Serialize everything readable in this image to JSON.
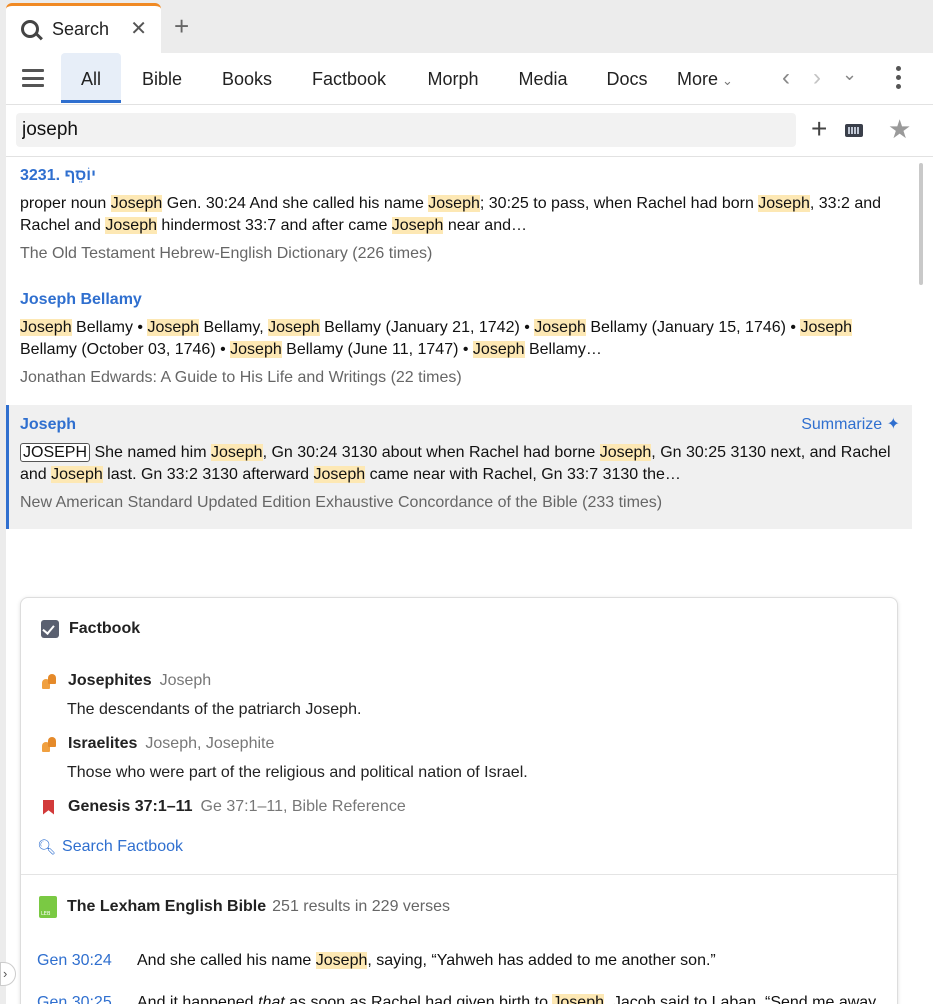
{
  "tab": {
    "label": "Search",
    "close": "✕",
    "new_tab": "+"
  },
  "nav": {
    "tabs": [
      "All",
      "Bible",
      "Books",
      "Factbook",
      "Morph",
      "Media",
      "Docs"
    ],
    "more": "More",
    "more_chevron": "⌄",
    "back": "‹",
    "forward": "›",
    "history": "⌄"
  },
  "search": {
    "query": "joseph",
    "add": "+",
    "favorite": "★"
  },
  "results": [
    {
      "title": "3231. יוֹסֵף",
      "text_parts": [
        "proper noun ",
        "*Joseph",
        " Gen. 30:24 And she called his name ",
        "*Joseph",
        "; 30:25 to pass, when Rachel had born ",
        "*Joseph",
        ", 33:2 and Rachel and ",
        "*Joseph",
        " hindermost 33:7 and after came ",
        "*Joseph",
        " near and…"
      ],
      "source": "The Old Testament Hebrew-English Dictionary (226 times)"
    },
    {
      "title": "Joseph Bellamy",
      "text_parts": [
        "*Joseph",
        " Bellamy • ",
        "*Joseph",
        " Bellamy, ",
        "*Joseph",
        " Bellamy (January 21, 1742) • ",
        "*Joseph",
        " Bellamy (January 15, 1746) • ",
        "*Joseph",
        " Bellamy (October 03, 1746) • ",
        "*Joseph",
        " Bellamy (June 11, 1747) • ",
        "*Joseph",
        " Bellamy…"
      ],
      "source": "Jonathan Edwards: A Guide to His Life and Writings (22 times)"
    },
    {
      "title": "Joseph",
      "summarize": "Summarize ✦",
      "text_parts": [
        "#JOSEPH",
        " She named him ",
        "*Joseph",
        ", Gn 30:24 3130 about when Rachel had borne ",
        "*Joseph",
        ", Gn 30:25 3130 next, and Rachel and ",
        "*Joseph",
        " last. Gn 33:2 3130 afterward ",
        "*Joseph",
        " came near with Rachel, Gn 33:7 3130 the…"
      ],
      "source": "New American Standard Updated Edition Exhaustive Concordance of the Bible (233 times)"
    }
  ],
  "factbook": {
    "title": "Factbook",
    "items": [
      {
        "name": "Josephites",
        "alias": "Joseph",
        "desc": "The descendants of the patriarch Joseph.",
        "icon": "people-icon"
      },
      {
        "name": "Israelites",
        "alias": "Joseph, Josephite",
        "desc": "Those who were part of the religious and political nation of Israel.",
        "icon": "people-icon"
      },
      {
        "name": "Genesis 37:1–11",
        "alias": "Ge 37:1–11, Bible Reference",
        "icon": "bookmark-icon"
      }
    ],
    "search_link": "Search Factbook"
  },
  "bible": {
    "title": "The Lexham English Bible",
    "count": "251 results in 229 verses",
    "verses": [
      {
        "ref": "Gen 30:24",
        "html_parts": [
          "And she called his name ",
          "*Joseph",
          ", saying, “Yahweh has added to me another son.”"
        ]
      },
      {
        "ref": "Gen 30:25",
        "html_parts": [
          "And it happened ",
          "_that",
          " as soon as Rachel had given birth to ",
          "*Joseph",
          ", Jacob said to Laban, “Send me away that I may go to my place and my land."
        ]
      }
    ]
  },
  "colors": {
    "accent": "#2f6fcf",
    "highlight": "#fde8b4",
    "tab_accent": "#f08a24"
  }
}
